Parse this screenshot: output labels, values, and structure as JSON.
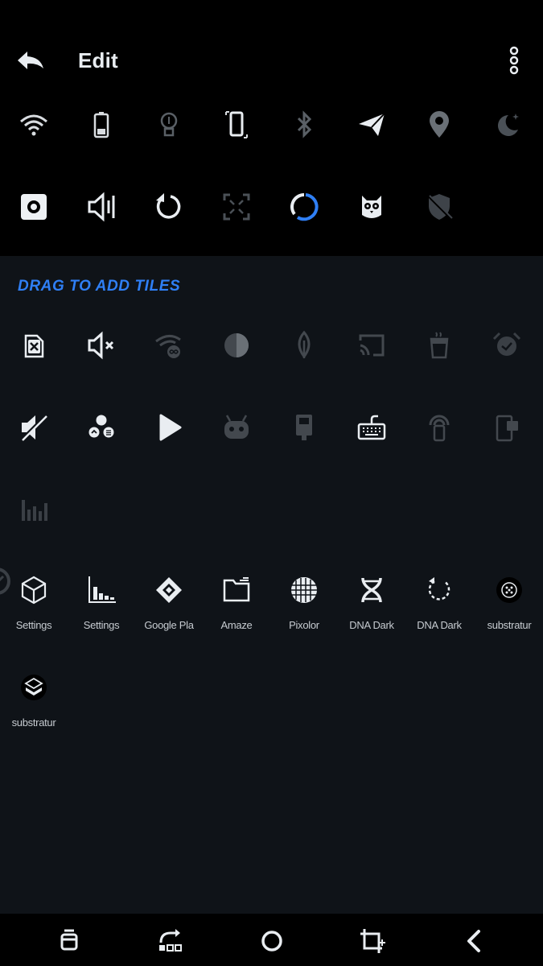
{
  "header": {
    "title": "Edit",
    "back_icon": "back-arrow-icon",
    "menu_icon": "more-vert-icon"
  },
  "active_tiles": [
    {
      "name": "wifi-icon"
    },
    {
      "name": "battery-icon"
    },
    {
      "name": "flashlight-icon"
    },
    {
      "name": "auto-rotate-icon"
    },
    {
      "name": "bluetooth-icon"
    },
    {
      "name": "airplane-mode-icon"
    },
    {
      "name": "location-icon"
    },
    {
      "name": "night-mode-icon"
    },
    {
      "name": "screen-record-icon"
    },
    {
      "name": "volume-panel-icon"
    },
    {
      "name": "sync-icon"
    },
    {
      "name": "immersive-mode-icon"
    },
    {
      "name": "data-saver-icon"
    },
    {
      "name": "caffeine-owl-icon"
    },
    {
      "name": "vpn-off-icon"
    }
  ],
  "available_section": {
    "title": "DRAG TO ADD TILES"
  },
  "available_tiles": [
    {
      "name": "no-sim-icon"
    },
    {
      "name": "volume-mute-icon"
    },
    {
      "name": "wifi-infinity-icon"
    },
    {
      "name": "contrast-icon"
    },
    {
      "name": "ambient-leaf-icon"
    },
    {
      "name": "cast-icon"
    },
    {
      "name": "coffee-icon"
    },
    {
      "name": "alarm-icon"
    },
    {
      "name": "sound-off-icon"
    },
    {
      "name": "apps-group-icon"
    },
    {
      "name": "play-icon"
    },
    {
      "name": "android-icon"
    },
    {
      "name": "usb-tether-icon"
    },
    {
      "name": "keyboard-icon"
    },
    {
      "name": "hotspot-icon"
    },
    {
      "name": "device-icon"
    },
    {
      "name": "signal-bars-icon"
    }
  ],
  "app_tiles": [
    {
      "label": "Settings",
      "icon": "cube-icon"
    },
    {
      "label": "Settings",
      "icon": "bar-chart-icon"
    },
    {
      "label": "Google Pla",
      "icon": "diamond-icon"
    },
    {
      "label": "Amaze",
      "icon": "folder-icon"
    },
    {
      "label": "Pixolor",
      "icon": "grid-circle-icon"
    },
    {
      "label": "DNA Dark",
      "icon": "dna-icon"
    },
    {
      "label": "DNA Dark",
      "icon": "refresh-dots-icon"
    },
    {
      "label": "substratur",
      "icon": "substratum-icon"
    },
    {
      "label": "substratur",
      "icon": "layers-icon"
    }
  ],
  "nav": [
    {
      "name": "recent-apps-icon"
    },
    {
      "name": "rotate-icon"
    },
    {
      "name": "home-icon"
    },
    {
      "name": "crop-icon"
    },
    {
      "name": "back-icon"
    }
  ],
  "colors": {
    "accent": "#2f7ff5",
    "top_bg": "#000000",
    "body_bg": "#0f1318"
  }
}
